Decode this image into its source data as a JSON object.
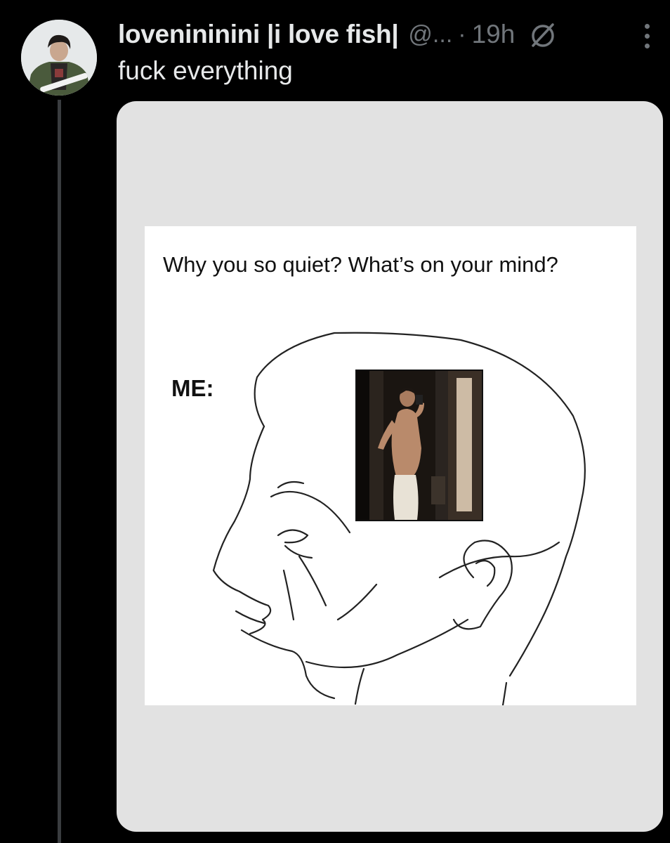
{
  "post": {
    "display_name": "lovenininini |i love fish|",
    "handle": "@...",
    "separator": "·",
    "time": "19h",
    "text": "fuck everything"
  },
  "icons": {
    "hidden": "circle-slash-icon",
    "more": "more-vertical-icon"
  },
  "meme": {
    "caption": "Why you so quiet? What’s on your mind?",
    "label": "ME:"
  },
  "colors": {
    "background": "#000000",
    "primary_text": "#e7e9ea",
    "secondary_text": "#71767b",
    "media_background": "#e2e2e2"
  }
}
